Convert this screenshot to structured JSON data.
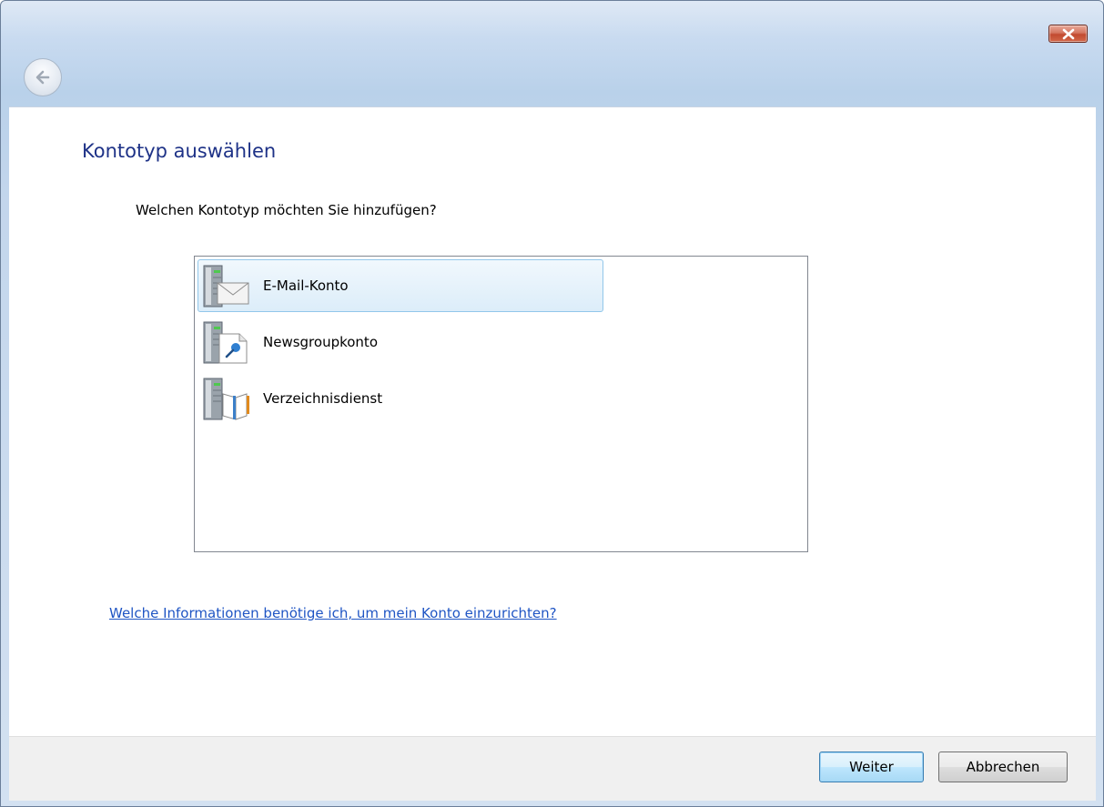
{
  "dialog": {
    "title": "Kontotyp auswählen",
    "question": "Welchen Kontotyp möchten Sie hinzufügen?",
    "account_types": [
      {
        "label": "E-Mail-Konto",
        "icon": "mail-server-icon",
        "selected": true
      },
      {
        "label": "Newsgroupkonto",
        "icon": "newsgroup-server-icon",
        "selected": false
      },
      {
        "label": "Verzeichnisdienst",
        "icon": "directory-server-icon",
        "selected": false
      }
    ],
    "help_link": "Welche Informationen benötige ich, um mein Konto einzurichten?"
  },
  "footer": {
    "next_label": "Weiter",
    "cancel_label": "Abbrechen"
  },
  "colors": {
    "title": "#1e3287",
    "link": "#1f55c4",
    "selection": "#dcedf9",
    "close_button": "#c24a30"
  }
}
